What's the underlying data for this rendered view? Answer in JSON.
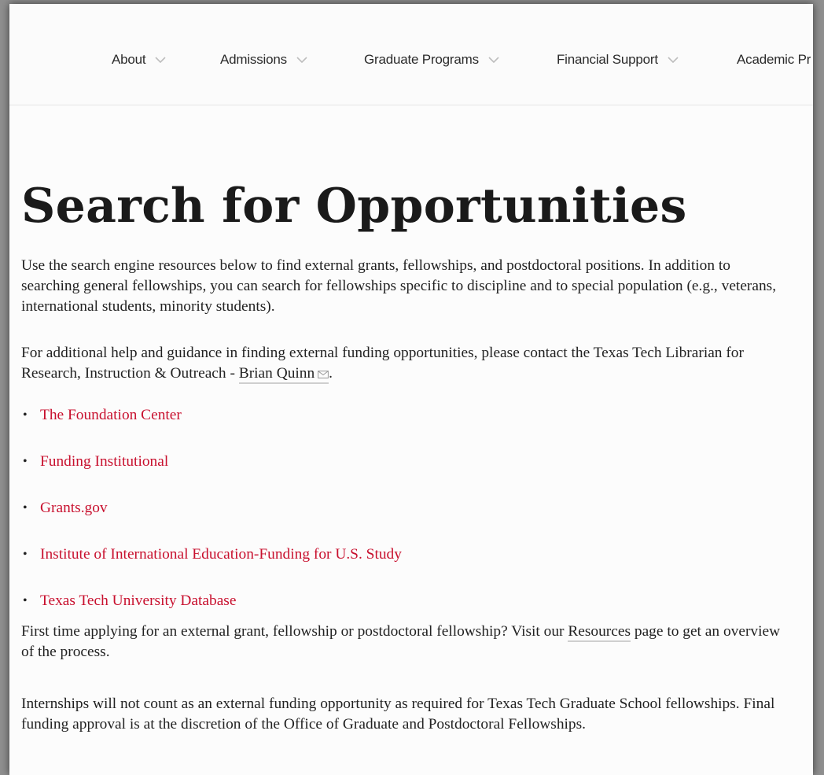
{
  "nav": {
    "items": [
      {
        "label": "About"
      },
      {
        "label": "Admissions"
      },
      {
        "label": "Graduate Programs"
      },
      {
        "label": "Financial Support"
      },
      {
        "label": "Academic Pr"
      }
    ]
  },
  "page": {
    "title": "Search for Opportunities",
    "intro": "Use the search engine resources below to find external grants, fellowships, and postdoctoral positions. In addition to searching general fellowships, you can search for fellowships specific to discipline and to special population (e.g., veterans, international students, minority students).",
    "help_prefix": "For additional help and guidance in finding external funding opportunities, please contact the Texas Tech Librarian for Research, Instruction & Outreach - ",
    "help_contact": "Brian Quinn",
    "help_suffix": ".",
    "links": [
      {
        "label": "The Foundation Center"
      },
      {
        "label": "Funding Institutional"
      },
      {
        "label": "Grants.gov"
      },
      {
        "label": "Institute of International Education-Funding for U.S. Study"
      },
      {
        "label": "Texas Tech University Database"
      }
    ],
    "first_time_prefix": "First time applying for an external grant, fellowship or postdoctoral fellowship? Visit our ",
    "first_time_link": "Resources",
    "first_time_suffix": " page to get an overview of the process.",
    "internships_note": "Internships will not count as an external funding opportunity as required for Texas Tech Graduate School fellowships.  Final funding approval is at the discretion of the Office of Graduate and Postdoctoral Fellowships."
  },
  "colors": {
    "link": "#c8102e",
    "text": "#222222",
    "background": "#fcfcfc"
  }
}
